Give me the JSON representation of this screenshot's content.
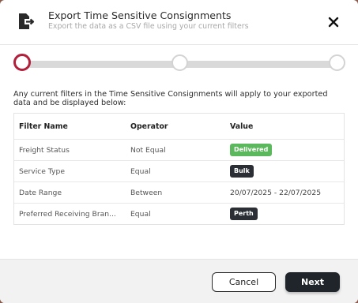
{
  "header": {
    "title": "Export Time Sensitive Consignments",
    "subtitle": "Export the data as a CSV file using your current filters",
    "icon": "export-file-icon",
    "close_icon": "close-icon"
  },
  "stepper": {
    "steps": [
      {
        "state": "active"
      },
      {
        "state": "pending"
      },
      {
        "state": "pending"
      }
    ],
    "active_color": "#b11f3a"
  },
  "info_text": "Any current filters in the Time Sensitive Consignments will apply to your exported data and be displayed below:",
  "table": {
    "headers": [
      "Filter Name",
      "Operator",
      "Value"
    ],
    "rows": [
      {
        "name": "Freight Status",
        "operator": "Not Equal",
        "value": "Delivered",
        "value_type": "badge-green"
      },
      {
        "name": "Service Type",
        "operator": "Equal",
        "value": "Bulk",
        "value_type": "badge-dark"
      },
      {
        "name": "Date Range",
        "operator": "Between",
        "value": "20/07/2025 - 22/07/2025",
        "value_type": "text"
      },
      {
        "name": "Preferred Receiving Bran...",
        "operator": "Equal",
        "value": "Perth",
        "value_type": "badge-dark"
      }
    ]
  },
  "footer": {
    "cancel_label": "Cancel",
    "next_label": "Next"
  },
  "colors": {
    "badge_green": "#5cb85c",
    "badge_dark": "#2b2f35",
    "primary_button": "#20252b"
  }
}
